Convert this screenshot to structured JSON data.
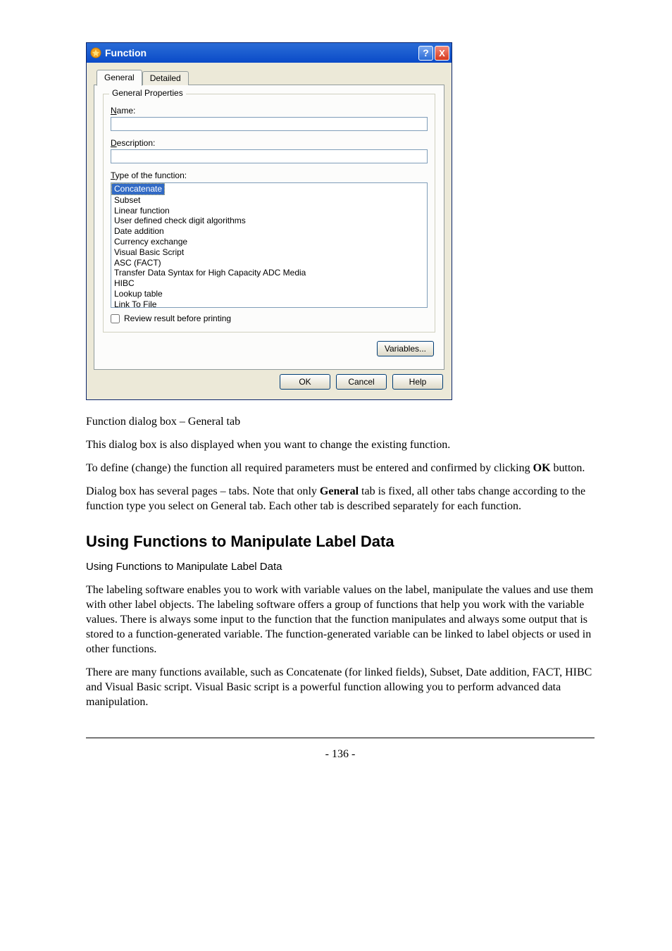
{
  "dialog": {
    "title": "Function",
    "help_glyph": "?",
    "close_glyph": "X",
    "tabs": {
      "general": "General",
      "detailed": "Detailed"
    },
    "group_legend": "General Properties",
    "name_label_ul": "N",
    "name_label_rest": "ame:",
    "name_value": "",
    "desc_label_ul": "D",
    "desc_label_rest": "escription:",
    "desc_value": "",
    "type_label_ul": "T",
    "type_label_rest": "ype of the function:",
    "listbox": {
      "options": [
        "Concatenate",
        "Subset",
        "Linear function",
        "User defined check digit algorithms",
        "Date addition",
        "Currency exchange",
        "Visual Basic Script",
        "ASC (FACT)",
        "Transfer Data Syntax for High Capacity ADC Media",
        "HIBC",
        "Lookup table",
        "Link To File"
      ],
      "selected_index": 0
    },
    "checkbox_label_ul": "R",
    "checkbox_label_rest": "eview result before printing",
    "variables_ul": "V",
    "variables_rest": "ariables...",
    "ok": "OK",
    "cancel": "Cancel",
    "help_ul": "H",
    "help_rest": "elp"
  },
  "caption": "Function dialog box – General tab",
  "p1": "This dialog box is also displayed when you want to change the existing function.",
  "p2_pre": "To define (change) the function all required parameters must be entered and confirmed by clicking ",
  "p2_bold": "OK",
  "p2_post": " button.",
  "p3_pre": "Dialog box has several pages – tabs. Note that only ",
  "p3_bold": "General",
  "p3_post": " tab is fixed, all other tabs change according to the function type you select on General tab. Each other tab is described separately for each function.",
  "h2": "Using Functions to Manipulate Label Data",
  "h3": "Using Functions to Manipulate Label Data",
  "p4": "The labeling software enables you to work with variable values on the label, manipulate the values and use them with other label objects. The labeling software offers a group of functions that help you work with the variable values. There is always some input to the function that the function manipulates and always some output that is stored to a function-generated variable. The function-generated variable can be linked to label objects or used in other functions.",
  "p5": "There are many functions available, such as Concatenate (for linked fields), Subset, Date addition, FACT, HIBC and Visual Basic script. Visual Basic script is a powerful function allowing you to perform advanced data manipulation.",
  "page_number": "- 136 -"
}
